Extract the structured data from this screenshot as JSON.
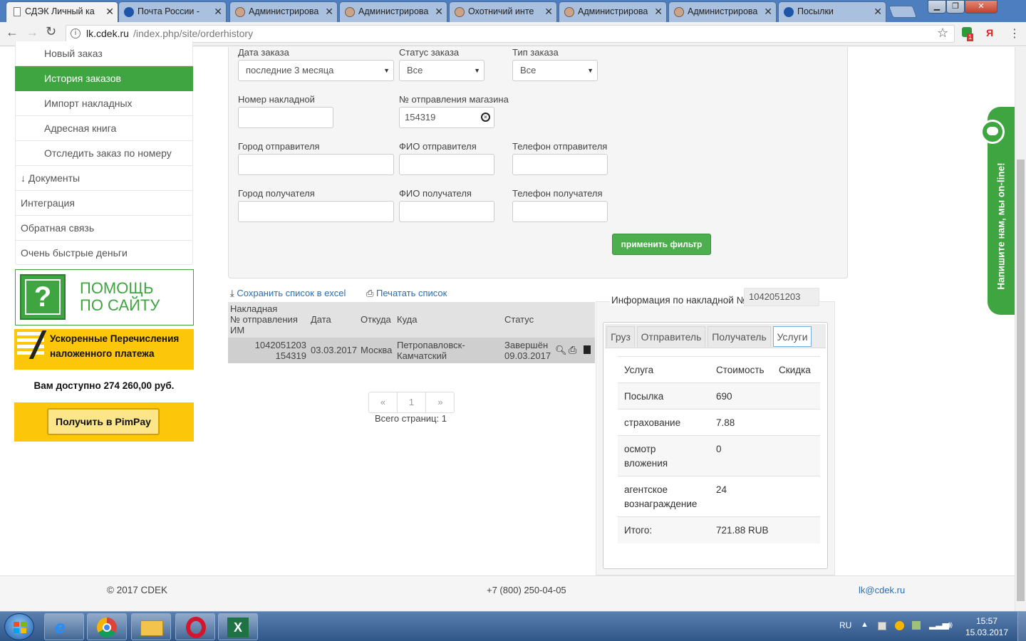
{
  "browser": {
    "tabs": [
      {
        "title": "СДЭК Личный ка",
        "icon": "page-icon"
      },
      {
        "title": "Почта России - ",
        "icon": "russian-post-icon"
      },
      {
        "title": "Администрирова",
        "icon": "admin-avatar-icon"
      },
      {
        "title": "Администрирова",
        "icon": "admin-avatar-icon"
      },
      {
        "title": "Охотничий инте",
        "icon": "admin-avatar-icon"
      },
      {
        "title": "Администрирова",
        "icon": "admin-avatar-icon"
      },
      {
        "title": "Администрирова",
        "icon": "admin-avatar-icon"
      },
      {
        "title": "Посылки",
        "icon": "russian-post-icon"
      }
    ],
    "url_host": "lk.cdek.ru",
    "url_path": "/index.php/site/orderhistory",
    "extension_badge": "1"
  },
  "sidebar": {
    "items": [
      {
        "label": "Новый заказ",
        "level": "sub"
      },
      {
        "label": "История заказов",
        "level": "sub",
        "active": true
      },
      {
        "label": "Импорт накладных",
        "level": "sub"
      },
      {
        "label": "Адресная книга",
        "level": "sub"
      },
      {
        "label": "Отследить заказ по номеру",
        "level": "sub"
      },
      {
        "label": "↓ Документы",
        "level": "top"
      },
      {
        "label": "Интеграция",
        "level": "top"
      },
      {
        "label": "Обратная связь",
        "level": "top"
      },
      {
        "label": "Очень быстрые деньги",
        "level": "top"
      }
    ],
    "help_banner": {
      "line1": "ПОМОЩЬ",
      "line2": "ПО САЙТУ",
      "icon_text": "?"
    },
    "pimpay": {
      "title_line1": "Ускоренные Перечисления",
      "title_line2": "наложенного платежа",
      "available": "Вам доступно 274 260,00 руб.",
      "button": "Получить в PimPay"
    }
  },
  "filter": {
    "order_date_label": "Дата заказа",
    "order_date_value": "последние 3 месяца",
    "order_status_label": "Статус заказа",
    "order_status_value": "Все",
    "order_type_label": "Тип заказа",
    "order_type_value": "Все",
    "waybill_label": "Номер накладной",
    "waybill_value": "",
    "shop_no_label": "№ отправления магазина",
    "shop_no_value": "154319",
    "sender_city_label": "Город отправителя",
    "sender_name_label": "ФИО отправителя",
    "sender_phone_label": "Телефон отправителя",
    "recipient_city_label": "Город получателя",
    "recipient_name_label": "ФИО получателя",
    "recipient_phone_label": "Телефон получателя",
    "apply_button": "применить фильтр"
  },
  "actions": {
    "save_excel": "Сохранить список в excel",
    "print_list": "Печатать список"
  },
  "orders": {
    "headers": {
      "waybill_l1": "Накладная",
      "waybill_l2": "№ отправления",
      "waybill_l3": "ИМ",
      "date": "Дата",
      "from": "Откуда",
      "to": "Куда",
      "status": "Статус"
    },
    "rows": [
      {
        "waybill": "1042051203",
        "shop_no": "154319",
        "date": "03.03.2017",
        "from": "Москва",
        "to_l1": "Петропавловск-",
        "to_l2": "Камчатский",
        "status_l1": "Завершён",
        "status_l2": "09.03.2017"
      }
    ],
    "pagination": {
      "prev": "«",
      "page": "1",
      "next": "»",
      "total": "Всего страниц: 1"
    }
  },
  "info": {
    "title": "Информация по накладной №",
    "waybill": "1042051203",
    "tabs": [
      "Груз",
      "Отправитель",
      "Получатель",
      "Услуги"
    ],
    "active_tab": "Услуги",
    "services_header": {
      "service": "Услуга",
      "cost": "Стоимость",
      "discount": "Скидка"
    },
    "services": [
      {
        "l1": "Посылка",
        "l2": "",
        "cost": "690"
      },
      {
        "l1": "страхование",
        "l2": "",
        "cost": "7.88"
      },
      {
        "l1": "осмотр",
        "l2": "вложения",
        "cost": "0"
      },
      {
        "l1": "агентское",
        "l2": "вознаграждение",
        "cost": "24"
      }
    ],
    "total_label": "Итого:",
    "total_value": "721.88 RUB"
  },
  "chat_widget": {
    "text": "Напишите нам, мы on-line!"
  },
  "footer": {
    "copyright": "© 2017 CDEK",
    "phone": "+7 (800) 250-04-05",
    "email": "lk@cdek.ru"
  },
  "taskbar": {
    "apps": [
      "ie-icon",
      "chrome-icon",
      "explorer-icon",
      "opera-icon",
      "excel-icon"
    ],
    "lang": "RU",
    "time": "15:57",
    "date": "15.03.2017"
  }
}
